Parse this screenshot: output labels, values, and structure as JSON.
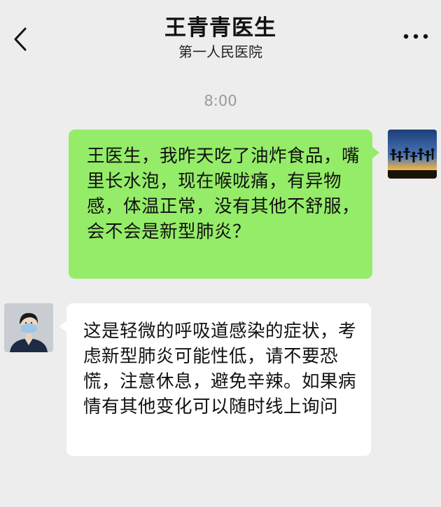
{
  "header": {
    "back_icon": "chevron-left-icon",
    "title": "王青青医生",
    "subtitle": "第一人民医院",
    "more_icon": "more-dots-icon"
  },
  "chat": {
    "timestamp": "8:00",
    "messages": [
      {
        "sender": "user",
        "avatar": "group-silhouette-sunset-avatar",
        "text": "王医生，我昨天吃了油炸食品，嘴里长水泡，现在喉咙痛，有异物感，体温正常，没有其他不舒服，会不会是新型肺炎？",
        "bubble_color": "#95ec69"
      },
      {
        "sender": "doctor",
        "avatar": "doctor-with-mask-avatar",
        "text": "这是轻微的呼吸道感染的症状，考虑新型肺炎可能性低，请不要恐慌，注意休息，避免辛辣。如果病情有其他变化可以随时线上询问",
        "bubble_color": "#ffffff"
      }
    ]
  }
}
